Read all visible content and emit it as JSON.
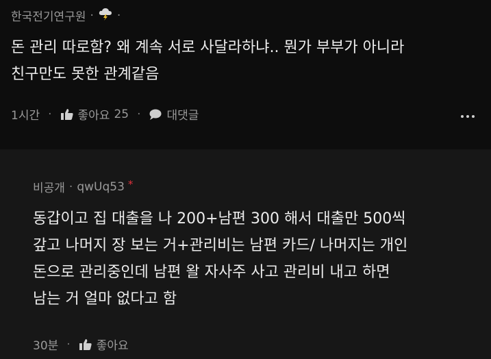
{
  "comment": {
    "author": "한국전기연구원",
    "lines": [
      "돈 관리 따로함? 왜 계속 서로 사달라하냐.. 뭔가 부부가 아니라",
      "친구만도 못한 관계같음"
    ],
    "time": "1시간",
    "like_label": "좋아요",
    "like_count": "25",
    "reply_label": "대댓글"
  },
  "reply": {
    "author": "비공개",
    "user_id": "qwUq53",
    "asterisk": "*",
    "lines": [
      "동갑이고 집 대출을 나 200+남편 300 해서 대출만 500씩",
      "갚고 나머지 장 보는 거+관리비는 남편 카드/ 나머지는 개인",
      "돈으로 관리중인데 남편 왈 자사주 사고 관리비 내고 하면",
      "남는 거 얼마 없다고 함"
    ],
    "time": "30분",
    "like_label": "좋아요"
  },
  "icons": {
    "badge": "cloud-lightning-icon",
    "like": "thumbs-up-icon",
    "reply": "speech-bubble-icon",
    "more": "more-dots-icon"
  },
  "colors": {
    "accent": "#e0323c"
  }
}
